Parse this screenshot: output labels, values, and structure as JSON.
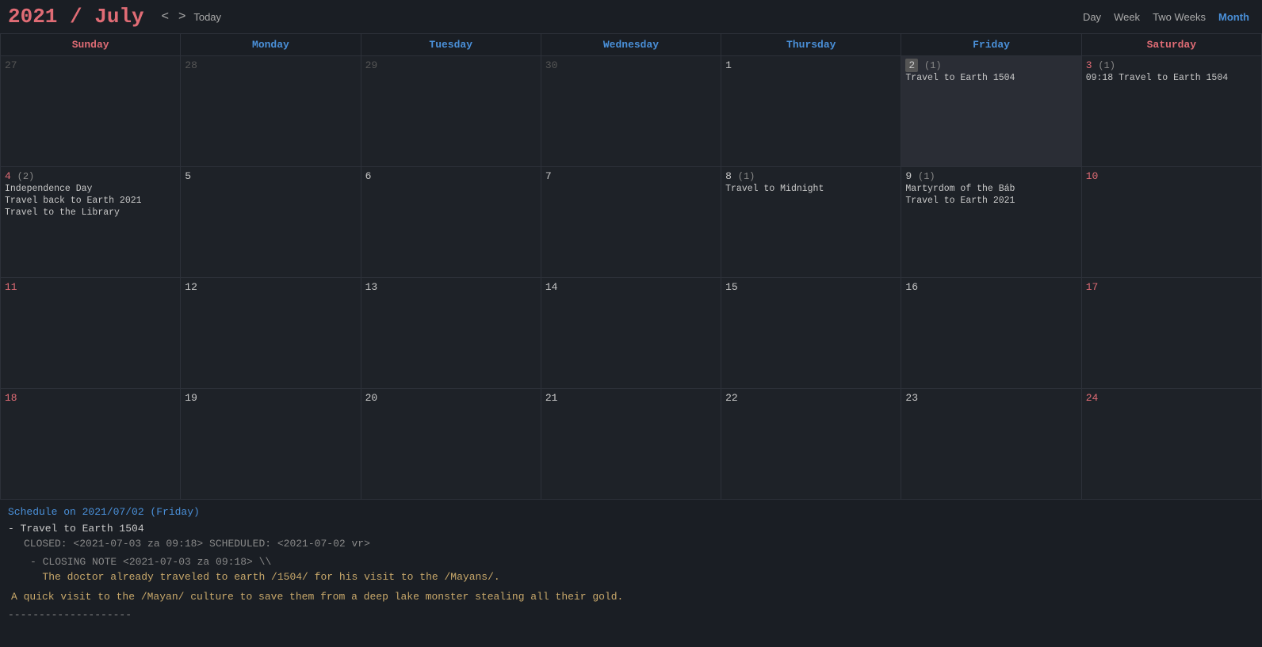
{
  "header": {
    "year": "2021",
    "slash": " / ",
    "month": "July",
    "nav_prev": "<",
    "nav_next": ">",
    "today_label": "Today",
    "views": [
      "Day",
      "Week",
      "Two Weeks",
      "Month"
    ],
    "active_view": "Month"
  },
  "weekdays": [
    {
      "label": "Sunday",
      "type": "weekend"
    },
    {
      "label": "Monday",
      "type": "weekday"
    },
    {
      "label": "Tuesday",
      "type": "weekday"
    },
    {
      "label": "Wednesday",
      "type": "weekday"
    },
    {
      "label": "Thursday",
      "type": "weekday"
    },
    {
      "label": "Friday",
      "type": "weekday"
    },
    {
      "label": "Saturday",
      "type": "weekend"
    }
  ],
  "weeks": [
    {
      "days": [
        {
          "num": "27",
          "other": true,
          "weekend": true,
          "events": []
        },
        {
          "num": "28",
          "other": true,
          "events": []
        },
        {
          "num": "29",
          "other": true,
          "events": []
        },
        {
          "num": "30",
          "other": true,
          "events": []
        },
        {
          "num": "1",
          "other": false,
          "events": []
        },
        {
          "num": "2",
          "badge": "(1)",
          "today": true,
          "other": false,
          "events": [
            "Travel to Earth 1504"
          ]
        },
        {
          "num": "3",
          "badge": "(1)",
          "weekend": true,
          "other": false,
          "events": [
            "09:18 Travel to Earth 1504"
          ]
        }
      ]
    },
    {
      "days": [
        {
          "num": "4",
          "badge": "(2)",
          "weekend": true,
          "other": false,
          "events": [
            "Independence Day",
            "Travel back to Earth 2021",
            "Travel to the Library"
          ]
        },
        {
          "num": "5",
          "other": false,
          "events": []
        },
        {
          "num": "6",
          "other": false,
          "events": []
        },
        {
          "num": "7",
          "other": false,
          "events": []
        },
        {
          "num": "8",
          "badge": "(1)",
          "other": false,
          "events": [
            "Travel to Midnight"
          ]
        },
        {
          "num": "9",
          "badge": "(1)",
          "other": false,
          "events": [
            "Martyrdom of the Báb",
            "Travel to Earth 2021"
          ]
        },
        {
          "num": "10",
          "weekend": true,
          "other": false,
          "events": []
        }
      ]
    },
    {
      "days": [
        {
          "num": "11",
          "weekend": true,
          "other": false,
          "events": []
        },
        {
          "num": "12",
          "other": false,
          "events": []
        },
        {
          "num": "13",
          "other": false,
          "events": []
        },
        {
          "num": "14",
          "other": false,
          "events": []
        },
        {
          "num": "15",
          "other": false,
          "events": []
        },
        {
          "num": "16",
          "other": false,
          "events": []
        },
        {
          "num": "17",
          "weekend": true,
          "other": false,
          "events": []
        }
      ]
    },
    {
      "days": [
        {
          "num": "18",
          "weekend": true,
          "other": false,
          "events": []
        },
        {
          "num": "19",
          "other": false,
          "events": []
        },
        {
          "num": "20",
          "other": false,
          "events": []
        },
        {
          "num": "21",
          "other": false,
          "events": []
        },
        {
          "num": "22",
          "other": false,
          "events": []
        },
        {
          "num": "23",
          "other": false,
          "events": []
        },
        {
          "num": "24",
          "weekend": true,
          "other": false,
          "events": []
        }
      ]
    }
  ],
  "schedule": {
    "title": "Schedule on 2021/07/02 (Friday)",
    "items": [
      {
        "title": "- Travel to Earth 1504",
        "meta": "CLOSED: <2021-07-03 za 09:18> SCHEDULED: <2021-07-02 vr>",
        "closing_note_label": "- CLOSING NOTE <2021-07-03 za 09:18> \\\\",
        "closing_note_line1": "The doctor already traveled to earth /1504/ for his visit to the /Mayans/.",
        "description": "A quick visit to the /Mayan/ culture to save them from a deep lake monster stealing all their gold."
      }
    ],
    "separator": "--------------------"
  }
}
